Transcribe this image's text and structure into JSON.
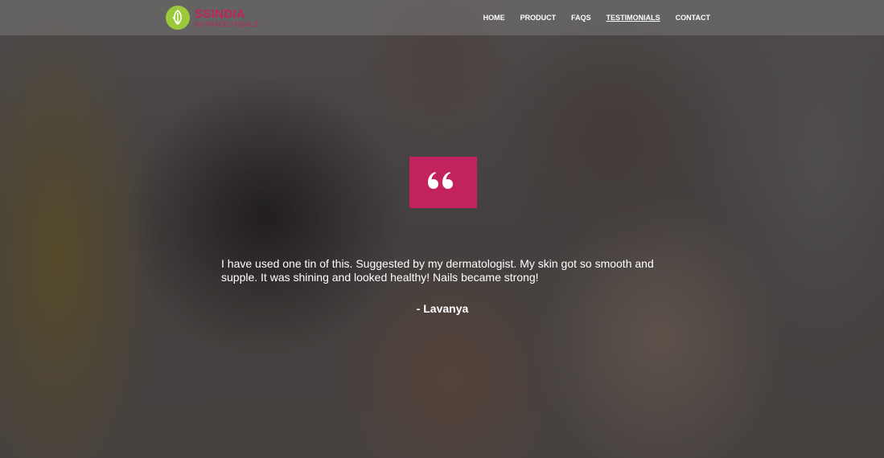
{
  "brand": {
    "name": "SSINDIA",
    "tagline": "NUTRACEUTICALS",
    "accent_color": "#c2225e",
    "logo_color": "#9cc83b"
  },
  "nav": {
    "items": [
      {
        "label": "HOME",
        "active": false
      },
      {
        "label": "PRODUCT",
        "active": false
      },
      {
        "label": "FAQS",
        "active": false
      },
      {
        "label": "TESTIMONIALS",
        "active": true
      },
      {
        "label": "CONTACT",
        "active": false
      }
    ]
  },
  "testimonial": {
    "icon": "quote-icon",
    "text": "I have used one tin of this. Suggested by my dermatologist. My skin got so smooth and supple. It was shining and looked healthy! Nails became strong!",
    "author": "- Lavanya"
  }
}
